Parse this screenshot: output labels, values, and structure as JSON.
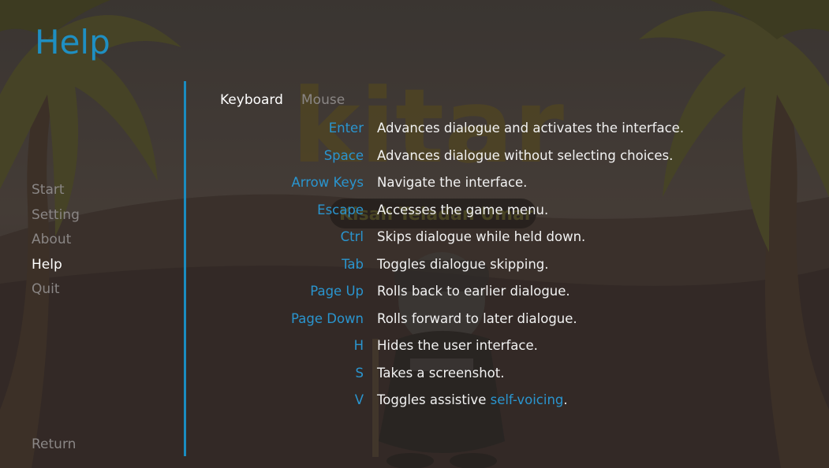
{
  "screen": {
    "title": "Help"
  },
  "nav": {
    "items": [
      {
        "label": "Start",
        "selected": false
      },
      {
        "label": "Setting",
        "selected": false
      },
      {
        "label": "About",
        "selected": false
      },
      {
        "label": "Help",
        "selected": true
      },
      {
        "label": "Quit",
        "selected": false
      }
    ],
    "return_label": "Return"
  },
  "tabs": [
    {
      "label": "Keyboard",
      "active": true
    },
    {
      "label": "Mouse",
      "active": false
    }
  ],
  "bindings": [
    {
      "key": "Enter",
      "description": "Advances dialogue and activates the interface."
    },
    {
      "key": "Space",
      "description": "Advances dialogue without selecting choices."
    },
    {
      "key": "Arrow Keys",
      "description": "Navigate the interface."
    },
    {
      "key": "Escape",
      "description": "Accesses the game menu."
    },
    {
      "key": "Ctrl",
      "description": "Skips dialogue while held down."
    },
    {
      "key": "Tab",
      "description": "Toggles dialogue skipping."
    },
    {
      "key": "Page Up",
      "description": "Rolls back to earlier dialogue."
    },
    {
      "key": "Page Down",
      "description": "Rolls forward to later dialogue."
    },
    {
      "key": "H",
      "description": "Hides the user interface."
    },
    {
      "key": "S",
      "description": "Takes a screenshot."
    },
    {
      "key": "V",
      "description": "Toggles assistive ",
      "link": "self-voicing",
      "suffix": "."
    }
  ],
  "background": {
    "logo_text": "kitar",
    "logo_subtitle": "Kisah Teladan Umar"
  },
  "colors": {
    "accent": "#1f8fc2",
    "text": "#f2f2f2",
    "muted": "#8a8685"
  }
}
